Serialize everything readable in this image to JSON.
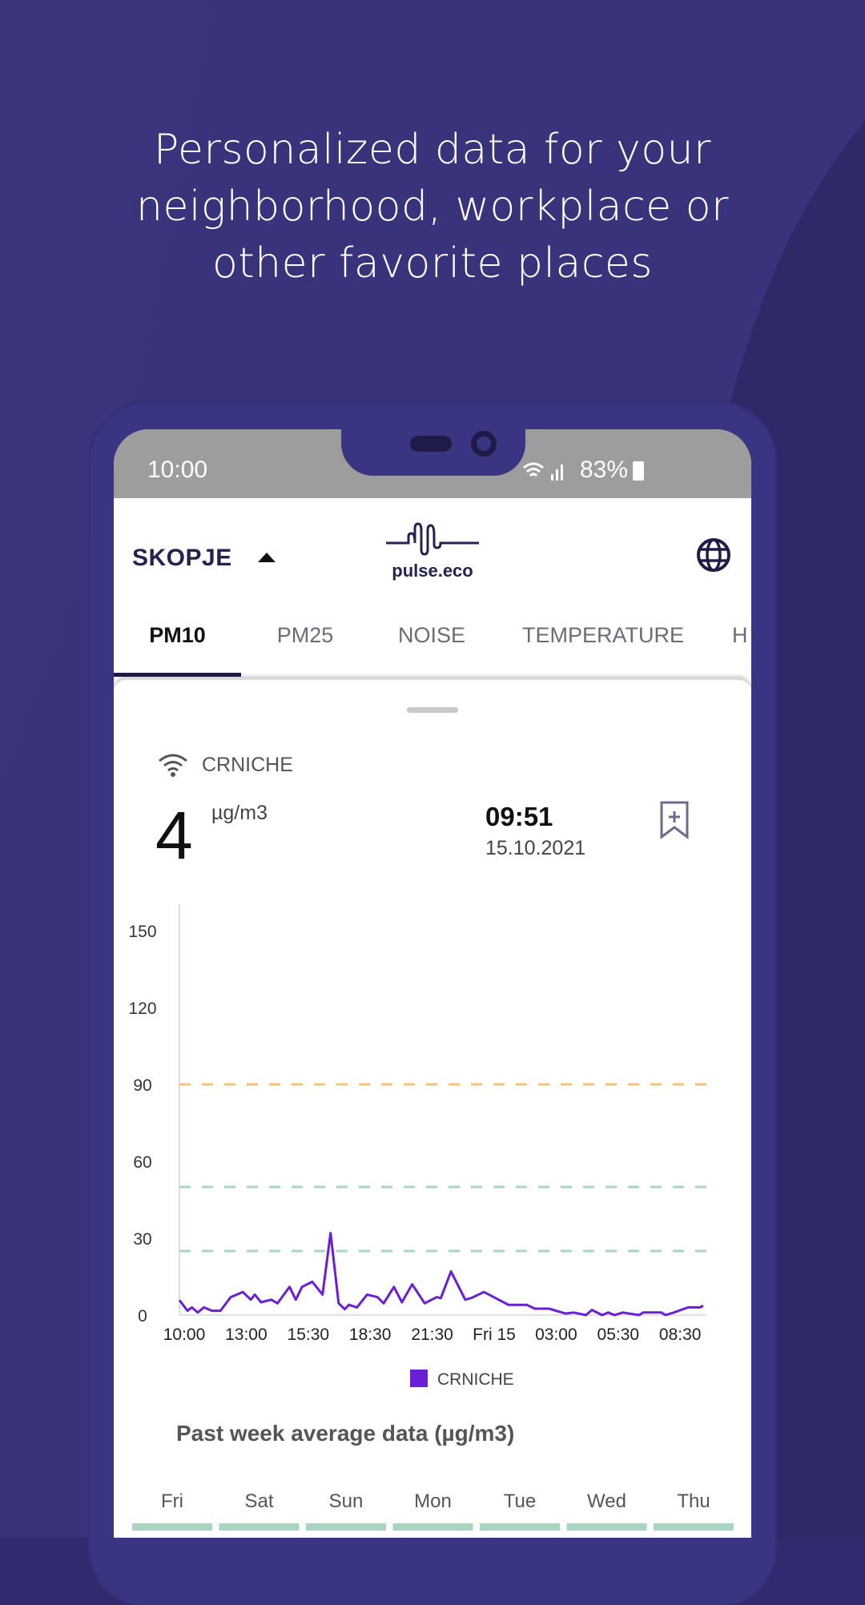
{
  "headline": [
    "Personalized data for your",
    "neighborhood, workplace or",
    "other favorite places"
  ],
  "status_bar": {
    "time": "10:00",
    "battery": "83%"
  },
  "app_bar": {
    "city": "SKOPJE",
    "logo_text": "pulse.eco",
    "globe_icon": "globe-icon",
    "caret_icon": "caret-up-icon"
  },
  "tabs": [
    {
      "label": "PM10",
      "active": true
    },
    {
      "label": "PM25"
    },
    {
      "label": "NOISE"
    },
    {
      "label": "TEMPERATURE"
    },
    {
      "label": "H"
    }
  ],
  "sensor": {
    "name": "CRNICHE",
    "value": "4",
    "unit": "µg/m3",
    "time": "09:51",
    "date": "15.10.2021",
    "bookmark_icon": "bookmark-add-icon"
  },
  "colors": {
    "background": "#38337a",
    "line": "#6a1fd6",
    "threshold_orange": "#f5c27a",
    "threshold_green": "#a8d5be",
    "week_bar": "#a8d5be"
  },
  "chart_data": {
    "type": "line",
    "y_ticks": [
      0,
      30,
      60,
      90,
      120,
      150
    ],
    "ylim": [
      0,
      165
    ],
    "x_ticks": [
      "10:00",
      "13:00",
      "15:30",
      "18:30",
      "21:30",
      "Fri 15",
      "03:00",
      "05:30",
      "08:30"
    ],
    "xlim": [
      "10:00",
      "09:51"
    ],
    "thresholds": [
      {
        "value": 90,
        "color": "#f5c27a"
      },
      {
        "value": 50,
        "color": "#a8d5be"
      },
      {
        "value": 25,
        "color": "#a8d5be"
      }
    ],
    "grid": false,
    "legend": "bottom",
    "series": [
      {
        "name": "CRNICHE",
        "color": "#6a1fd6",
        "points": [
          [
            "10:00",
            5.8
          ],
          [
            "10:22",
            1.7
          ],
          [
            "10:34",
            3
          ],
          [
            "10:50",
            1
          ],
          [
            "11:07",
            3
          ],
          [
            "11:29",
            1.7
          ],
          [
            "11:52",
            1.7
          ],
          [
            "12:20",
            7
          ],
          [
            "12:53",
            9
          ],
          [
            "13:15",
            6
          ],
          [
            "13:26",
            8
          ],
          [
            "13:43",
            5
          ],
          [
            "14:11",
            6
          ],
          [
            "14:28",
            4.6
          ],
          [
            "15:01",
            11
          ],
          [
            "15:18",
            6
          ],
          [
            "15:35",
            11
          ],
          [
            "16:03",
            13
          ],
          [
            "16:31",
            8
          ],
          [
            "16:53",
            32
          ],
          [
            "17:15",
            4.6
          ],
          [
            "17:32",
            2.3
          ],
          [
            "17:43",
            4
          ],
          [
            "18:05",
            3
          ],
          [
            "18:33",
            8
          ],
          [
            "19:01",
            7
          ],
          [
            "19:18",
            4.6
          ],
          [
            "19:46",
            11
          ],
          [
            "20:08",
            5
          ],
          [
            "20:36",
            12
          ],
          [
            "21:10",
            4.6
          ],
          [
            "21:43",
            7
          ],
          [
            "21:54",
            6.6
          ],
          [
            "22:22",
            17
          ],
          [
            "23:01",
            6
          ],
          [
            "23:18",
            6.7
          ],
          [
            "23:52",
            9
          ],
          [
            "00:59",
            4
          ],
          [
            "01:49",
            4
          ],
          [
            "02:11",
            2.5
          ],
          [
            "02:50",
            2.5
          ],
          [
            "03:35",
            0.6
          ],
          [
            "03:57",
            1
          ],
          [
            "04:31",
            0
          ],
          [
            "04:47",
            2
          ],
          [
            "05:15",
            0
          ],
          [
            "05:32",
            1
          ],
          [
            "05:49",
            0
          ],
          [
            "06:11",
            1
          ],
          [
            "06:56",
            0
          ],
          [
            "07:07",
            1
          ],
          [
            "07:57",
            1
          ],
          [
            "08:08",
            0
          ],
          [
            "08:31",
            1
          ],
          [
            "09:10",
            3
          ],
          [
            "09:43",
            3
          ],
          [
            "09:51",
            3.7
          ]
        ]
      }
    ]
  },
  "week": {
    "title": "Past week average data (µg/m3)",
    "days": [
      "Fri",
      "Sat",
      "Sun",
      "Mon",
      "Tue",
      "Wed",
      "Thu"
    ]
  }
}
